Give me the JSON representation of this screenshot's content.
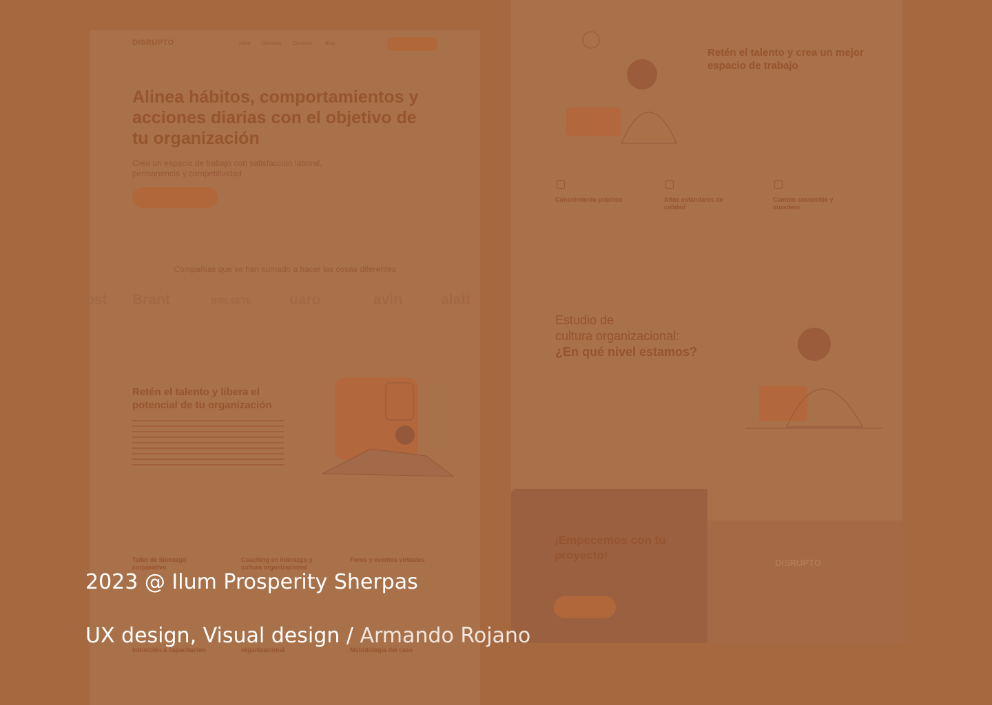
{
  "left_page": {
    "brand": "DISRUPTO",
    "nav": [
      "Inicio",
      "Servicios",
      "Contacto",
      "Blog"
    ],
    "hero_title": "Alinea hábitos, comportamientos y acciones diarias con el objetivo de tu organización",
    "hero_subtitle": "Crea un espacio de trabajo con satisfacción laboral, permanencia y competitividad",
    "companies_title": "Compañías que se han sumado a hacer las cosas diferentes",
    "logos": [
      "ost",
      "Brant",
      "BRILSETE",
      "uaro",
      "avin",
      "alatt"
    ],
    "section2_title": "Retén el talento y libera el potencial de tu organización",
    "features_row1": [
      "Taller de liderazgo corporativo",
      "Coaching en liderazgo y cultura organizacional",
      "Foros y eventos virtuales"
    ],
    "features_row2": [
      "Inducción a capacitación",
      "organizacional",
      "Metodología del caso"
    ]
  },
  "right_page": {
    "title1": "Retén el talento y crea un mejor espacio de trabajo",
    "features": [
      "Conocimiento práctico",
      "Altos estándares de calidad",
      "Cambio sostenible y duradero"
    ],
    "study_title_line1": "Estudio de",
    "study_title_line2": "cultura organizacional:",
    "study_title_line3": "¿En qué nivel estamos?",
    "start_title": "¡Empecemos con tu proyecto!",
    "footer_brand": "DISRUPTO"
  },
  "caption": {
    "line1": "2023 @ Ilum Prosperity Sherpas",
    "roles": "UX design, Visual design /",
    "author": "Armando Rojano"
  },
  "colors": {
    "background": "#a6683f",
    "text": "#ffffff"
  }
}
